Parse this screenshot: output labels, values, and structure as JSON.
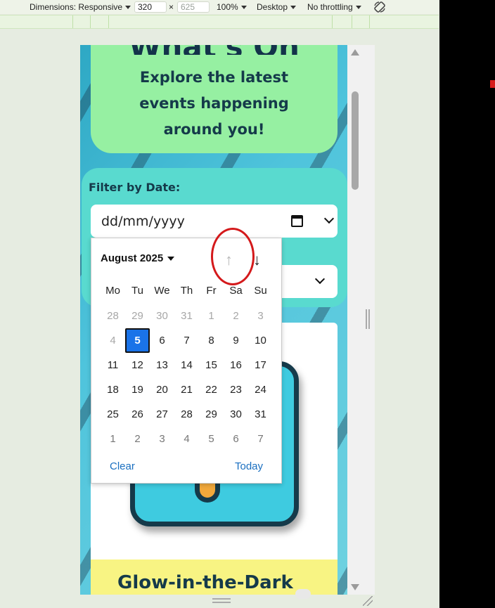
{
  "toolbar": {
    "dimensions_label": "Dimensions: Responsive",
    "width": "320",
    "times": "×",
    "height_placeholder": "625",
    "zoom": "100%",
    "device": "Desktop",
    "throttling": "No throttling"
  },
  "hero": {
    "title": "What's On",
    "subtitle": "Explore the latest events happening around you!"
  },
  "filter": {
    "label": "Filter by Date:",
    "date_placeholder": "dd/mm/yyyy"
  },
  "event": {
    "title": "Glow-in-the-Dark"
  },
  "picker": {
    "month": "August 2025",
    "up_arrow": "↑",
    "down_arrow": "↓",
    "weekdays": [
      "Mo",
      "Tu",
      "We",
      "Th",
      "Fr",
      "Sa",
      "Su"
    ],
    "weeks": [
      [
        "28",
        "29",
        "30",
        "31",
        "1",
        "2",
        "3"
      ],
      [
        "4",
        "5",
        "6",
        "7",
        "8",
        "9",
        "10"
      ],
      [
        "11",
        "12",
        "13",
        "14",
        "15",
        "16",
        "17"
      ],
      [
        "18",
        "19",
        "20",
        "21",
        "22",
        "23",
        "24"
      ],
      [
        "25",
        "26",
        "27",
        "28",
        "29",
        "30",
        "31"
      ],
      [
        "1",
        "2",
        "3",
        "4",
        "5",
        "6",
        "7"
      ]
    ],
    "selected_day": "5",
    "clear_label": "Clear",
    "today_label": "Today"
  },
  "colors": {
    "selected": "#1a73e8",
    "annotation": "#d4191b",
    "hero_bg": "#96f0a2",
    "band_bg": "#f8f483"
  }
}
